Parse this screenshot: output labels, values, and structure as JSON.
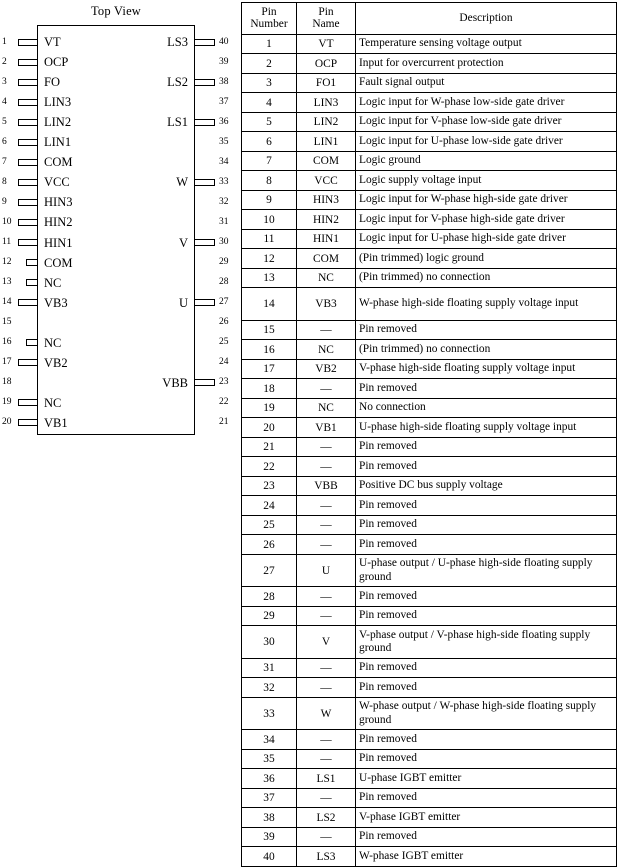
{
  "diagram": {
    "title": "Top View",
    "left_pins": [
      {
        "number": "1",
        "label": "VT",
        "lead": "full"
      },
      {
        "number": "2",
        "label": "OCP",
        "lead": "full"
      },
      {
        "number": "3",
        "label": "FO",
        "lead": "full"
      },
      {
        "number": "4",
        "label": "LIN3",
        "lead": "full"
      },
      {
        "number": "5",
        "label": "LIN2",
        "lead": "full"
      },
      {
        "number": "6",
        "label": "LIN1",
        "lead": "full"
      },
      {
        "number": "7",
        "label": "COM",
        "lead": "full"
      },
      {
        "number": "8",
        "label": "VCC",
        "lead": "full"
      },
      {
        "number": "9",
        "label": "HIN3",
        "lead": "full"
      },
      {
        "number": "10",
        "label": "HIN2",
        "lead": "full"
      },
      {
        "number": "11",
        "label": "HIN1",
        "lead": "full"
      },
      {
        "number": "12",
        "label": "COM",
        "lead": "short"
      },
      {
        "number": "13",
        "label": "NC",
        "lead": "short"
      },
      {
        "number": "14",
        "label": "VB3",
        "lead": "full"
      },
      {
        "number": "15",
        "label": "",
        "lead": "none"
      },
      {
        "number": "16",
        "label": "NC",
        "lead": "short"
      },
      {
        "number": "17",
        "label": "VB2",
        "lead": "full"
      },
      {
        "number": "18",
        "label": "",
        "lead": "none"
      },
      {
        "number": "19",
        "label": "NC",
        "lead": "full"
      },
      {
        "number": "20",
        "label": "VB1",
        "lead": "full"
      }
    ],
    "right_pins": [
      {
        "number": "40",
        "label": "LS3",
        "lead": "full"
      },
      {
        "number": "39",
        "label": "",
        "lead": "none"
      },
      {
        "number": "38",
        "label": "LS2",
        "lead": "full"
      },
      {
        "number": "37",
        "label": "",
        "lead": "none"
      },
      {
        "number": "36",
        "label": "LS1",
        "lead": "full"
      },
      {
        "number": "35",
        "label": "",
        "lead": "none"
      },
      {
        "number": "34",
        "label": "",
        "lead": "none"
      },
      {
        "number": "33",
        "label": "W",
        "lead": "full"
      },
      {
        "number": "32",
        "label": "",
        "lead": "none"
      },
      {
        "number": "31",
        "label": "",
        "lead": "none"
      },
      {
        "number": "30",
        "label": "V",
        "lead": "full"
      },
      {
        "number": "29",
        "label": "",
        "lead": "none"
      },
      {
        "number": "28",
        "label": "",
        "lead": "none"
      },
      {
        "number": "27",
        "label": "U",
        "lead": "full"
      },
      {
        "number": "26",
        "label": "",
        "lead": "none"
      },
      {
        "number": "25",
        "label": "",
        "lead": "none"
      },
      {
        "number": "24",
        "label": "",
        "lead": "none"
      },
      {
        "number": "23",
        "label": "VBB",
        "lead": "full"
      },
      {
        "number": "22",
        "label": "",
        "lead": "none"
      },
      {
        "number": "21",
        "label": "",
        "lead": "none"
      }
    ]
  },
  "table": {
    "headers": {
      "number_line1": "Pin",
      "number_line2": "Number",
      "name_line1": "Pin",
      "name_line2": "Name",
      "description": "Description"
    },
    "rows": [
      {
        "number": "1",
        "name": "VT",
        "description": "Temperature sensing voltage output",
        "lines": 1
      },
      {
        "number": "2",
        "name": "OCP",
        "description": "Input for overcurrent protection",
        "lines": 1
      },
      {
        "number": "3",
        "name": "FO1",
        "description": "Fault signal output",
        "lines": 1
      },
      {
        "number": "4",
        "name": "LIN3",
        "description": "Logic input for W-phase low-side gate driver",
        "lines": 1
      },
      {
        "number": "5",
        "name": "LIN2",
        "description": "Logic input for V-phase low-side gate driver",
        "lines": 1
      },
      {
        "number": "6",
        "name": "LIN1",
        "description": "Logic input for U-phase low-side gate driver",
        "lines": 1
      },
      {
        "number": "7",
        "name": "COM",
        "description": "Logic ground",
        "lines": 1
      },
      {
        "number": "8",
        "name": "VCC",
        "description": "Logic supply voltage input",
        "lines": 1
      },
      {
        "number": "9",
        "name": "HIN3",
        "description": "Logic input for W-phase high-side gate driver",
        "lines": 1
      },
      {
        "number": "10",
        "name": "HIN2",
        "description": "Logic input for V-phase high-side gate driver",
        "lines": 1
      },
      {
        "number": "11",
        "name": "HIN1",
        "description": "Logic input for U-phase high-side gate driver",
        "lines": 1
      },
      {
        "number": "12",
        "name": "COM",
        "description": "(Pin trimmed) logic ground",
        "lines": 1
      },
      {
        "number": "13",
        "name": "NC",
        "description": "(Pin trimmed) no connection",
        "lines": 1
      },
      {
        "number": "14",
        "name": "VB3",
        "description": "W-phase high-side floating supply voltage input",
        "lines": 2
      },
      {
        "number": "15",
        "name": "—",
        "description": "Pin removed",
        "lines": 1
      },
      {
        "number": "16",
        "name": "NC",
        "description": "(Pin trimmed) no connection",
        "lines": 1
      },
      {
        "number": "17",
        "name": "VB2",
        "description": "V-phase high-side floating supply voltage input",
        "lines": 1
      },
      {
        "number": "18",
        "name": "—",
        "description": "Pin removed",
        "lines": 1
      },
      {
        "number": "19",
        "name": "NC",
        "description": "No connection",
        "lines": 1
      },
      {
        "number": "20",
        "name": "VB1",
        "description": "U-phase high-side floating supply voltage input",
        "lines": 1
      },
      {
        "number": "21",
        "name": "—",
        "description": "Pin removed",
        "lines": 1
      },
      {
        "number": "22",
        "name": "—",
        "description": "Pin removed",
        "lines": 1
      },
      {
        "number": "23",
        "name": "VBB",
        "description": "Positive DC bus supply voltage",
        "lines": 1
      },
      {
        "number": "24",
        "name": "—",
        "description": "Pin removed",
        "lines": 1
      },
      {
        "number": "25",
        "name": "—",
        "description": "Pin removed",
        "lines": 1
      },
      {
        "number": "26",
        "name": "—",
        "description": "Pin removed",
        "lines": 1
      },
      {
        "number": "27",
        "name": "U",
        "description": "U-phase output / U-phase high-side floating supply ground",
        "lines": 2
      },
      {
        "number": "28",
        "name": "—",
        "description": "Pin removed",
        "lines": 1
      },
      {
        "number": "29",
        "name": "—",
        "description": "Pin removed",
        "lines": 1
      },
      {
        "number": "30",
        "name": "V",
        "description": "V-phase output / V-phase high-side floating supply ground",
        "lines": 2
      },
      {
        "number": "31",
        "name": "—",
        "description": "Pin removed",
        "lines": 1
      },
      {
        "number": "32",
        "name": "—",
        "description": "Pin removed",
        "lines": 1
      },
      {
        "number": "33",
        "name": "W",
        "description": "W-phase output / W-phase high-side floating supply ground",
        "lines": 2
      },
      {
        "number": "34",
        "name": "—",
        "description": "Pin removed",
        "lines": 1
      },
      {
        "number": "35",
        "name": "—",
        "description": "Pin removed",
        "lines": 1
      },
      {
        "number": "36",
        "name": "LS1",
        "description": "U-phase IGBT emitter",
        "lines": 1
      },
      {
        "number": "37",
        "name": "—",
        "description": "Pin removed",
        "lines": 1
      },
      {
        "number": "38",
        "name": "LS2",
        "description": "V-phase IGBT emitter",
        "lines": 1
      },
      {
        "number": "39",
        "name": "—",
        "description": "Pin removed",
        "lines": 1
      },
      {
        "number": "40",
        "name": "LS3",
        "description": "W-phase IGBT emitter",
        "lines": 1
      }
    ]
  }
}
